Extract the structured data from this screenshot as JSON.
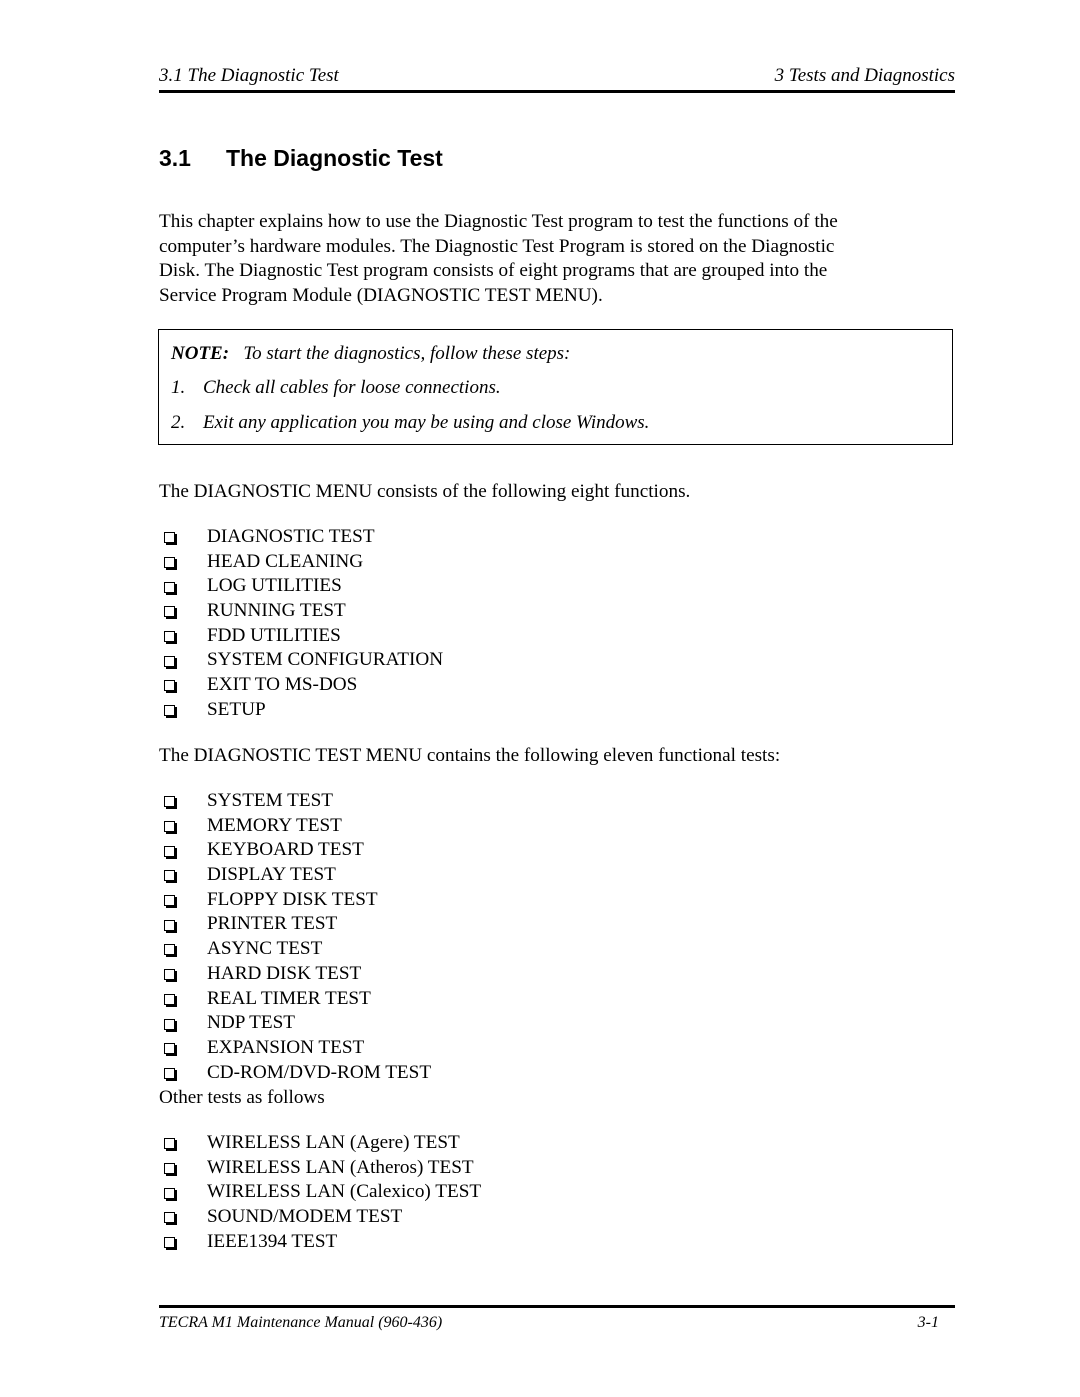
{
  "header": {
    "left": "3.1  The Diagnostic Test",
    "right": "3  Tests and Diagnostics"
  },
  "section": {
    "number": "3.1",
    "title": "The Diagnostic Test"
  },
  "intro": [
    "This chapter explains how to use the Diagnostic Test program to test the functions of the",
    "computer’s hardware modules. The Diagnostic Test Program is stored on the Diagnostic",
    "Disk. The Diagnostic Test program consists of eight programs that are grouped into the",
    "Service Program Module (DIAGNOSTIC TEST MENU)."
  ],
  "note": {
    "label": "NOTE:",
    "text": "To start the diagnostics, follow these steps:",
    "steps": [
      {
        "num": "1.",
        "text": "Check all cables for loose connections."
      },
      {
        "num": "2.",
        "text": "Exit any application you may be using and close Windows."
      }
    ]
  },
  "menu_intro": "The DIAGNOSTIC MENU consists of the following eight functions.",
  "menu_items": [
    "DIAGNOSTIC TEST",
    "HEAD CLEANING",
    "LOG UTILITIES",
    "RUNNING TEST",
    "FDD UTILITIES",
    "SYSTEM CONFIGURATION",
    "EXIT TO MS-DOS",
    "SETUP"
  ],
  "tests_intro": "The DIAGNOSTIC TEST MENU contains the following eleven functional tests:",
  "test_items": [
    "SYSTEM TEST",
    "MEMORY TEST",
    "KEYBOARD TEST",
    "DISPLAY TEST",
    "FLOPPY DISK TEST",
    "PRINTER TEST",
    "ASYNC TEST",
    "HARD DISK TEST",
    "REAL TIMER TEST",
    "NDP TEST",
    "EXPANSION TEST",
    "CD-ROM/DVD-ROM TEST"
  ],
  "other_intro": "Other tests as follows",
  "other_items": [
    "WIRELESS LAN (Agere) TEST",
    "WIRELESS LAN (Atheros) TEST",
    "WIRELESS LAN (Calexico) TEST",
    "SOUND/MODEM TEST",
    "IEEE1394 TEST"
  ],
  "footer": {
    "left": "TECRA M1 Maintenance Manual (960-436)",
    "right": "3-1"
  }
}
